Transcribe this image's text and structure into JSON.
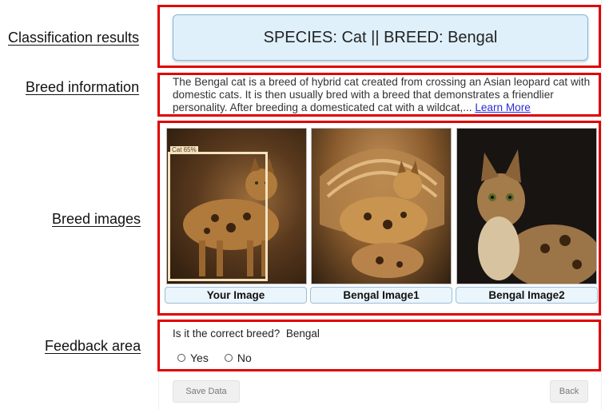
{
  "annotations": {
    "classification": "Classification results",
    "breed_info": "Breed information",
    "breed_images": "Breed images",
    "feedback": "Feedback area"
  },
  "result": {
    "text": "SPECIES: Cat || BREED: Bengal"
  },
  "breed_info": {
    "text": "The Bengal cat is a breed of hybrid cat created from crossing an Asian leopard cat with domestic cats. It is then usually bred with a breed that demonstrates a friendlier personality. After breeding a domesticated cat with a wildcat,... ",
    "link_label": "Learn More"
  },
  "images": {
    "detection_label": "Cat 65%",
    "captions": [
      "Your Image",
      "Bengal Image1",
      "Bengal Image2"
    ]
  },
  "feedback": {
    "question": "Is it the correct breed?  Bengal",
    "options": [
      "Yes",
      "No"
    ]
  },
  "buttons": {
    "save": "Save Data",
    "back": "Back"
  },
  "colors": {
    "annotation_red": "#e00000",
    "result_bg": "#dff0fb",
    "link": "#2b2bd9"
  }
}
